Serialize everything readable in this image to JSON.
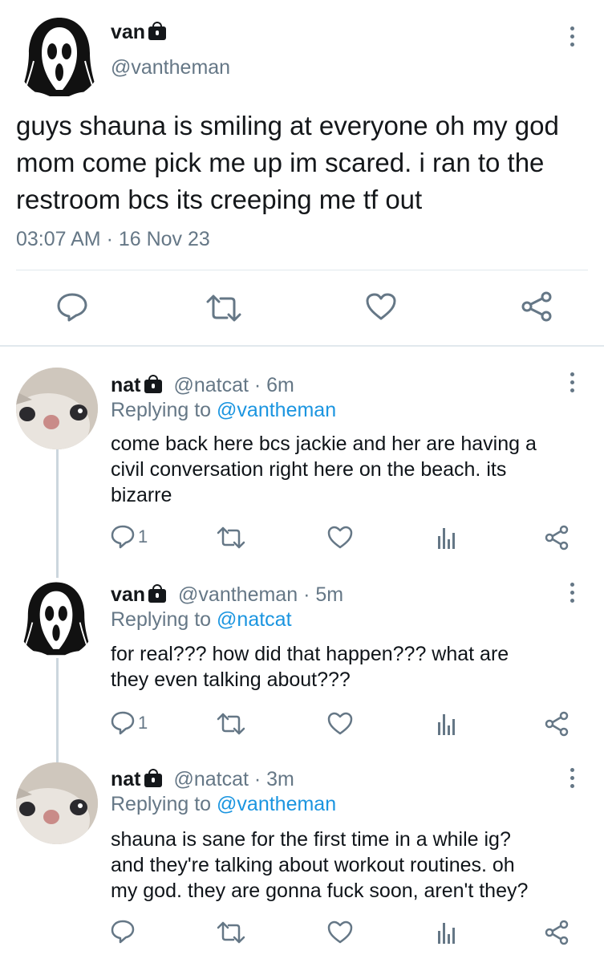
{
  "main_tweet": {
    "author_name": "van",
    "handle": "@vantheman",
    "text_lines": [
      "guys shauna is smiling at everyone oh my god",
      "mom come pick me up im scared. i ran to the",
      "restroom bcs its creeping me tf out"
    ],
    "timestamp": "03:07 AM · 16 Nov 23"
  },
  "replies": [
    {
      "author_name": "nat",
      "handle_time": "@natcat · 6m",
      "replying_prefix": "Replying to ",
      "replying_to": "@vantheman",
      "text_lines": [
        "come back here bcs jackie and her are having a",
        "civil conversation right here on the beach. its",
        "bizarre"
      ],
      "reply_count": "1"
    },
    {
      "author_name": "van",
      "handle_time": "@vantheman · 5m",
      "replying_prefix": "Replying to ",
      "replying_to": "@natcat",
      "text_lines": [
        "for real??? how did that happen??? what are",
        "they even talking about???"
      ],
      "reply_count": "1"
    },
    {
      "author_name": "nat",
      "handle_time": "@natcat · 3m",
      "replying_prefix": "Replying to ",
      "replying_to": "@vantheman",
      "text_lines": [
        "shauna is sane for the first time in a while ig?",
        "and they're talking about workout routines. oh",
        "my god. they are gonna fuck soon, aren't they?"
      ],
      "reply_count": ""
    }
  ],
  "colors": {
    "text": "#14171a",
    "secondary": "#657786",
    "link": "#1b95e0",
    "divider": "#e1e8ed",
    "thread_line": "#ccd6dd"
  },
  "icons": {
    "reply": "speech-bubble-icon",
    "retweet": "retweet-arrows-icon",
    "like": "heart-icon",
    "analytics": "bar-chart-icon",
    "share": "share-nodes-icon",
    "protected": "lock-icon",
    "more": "more-vertical-icon"
  }
}
